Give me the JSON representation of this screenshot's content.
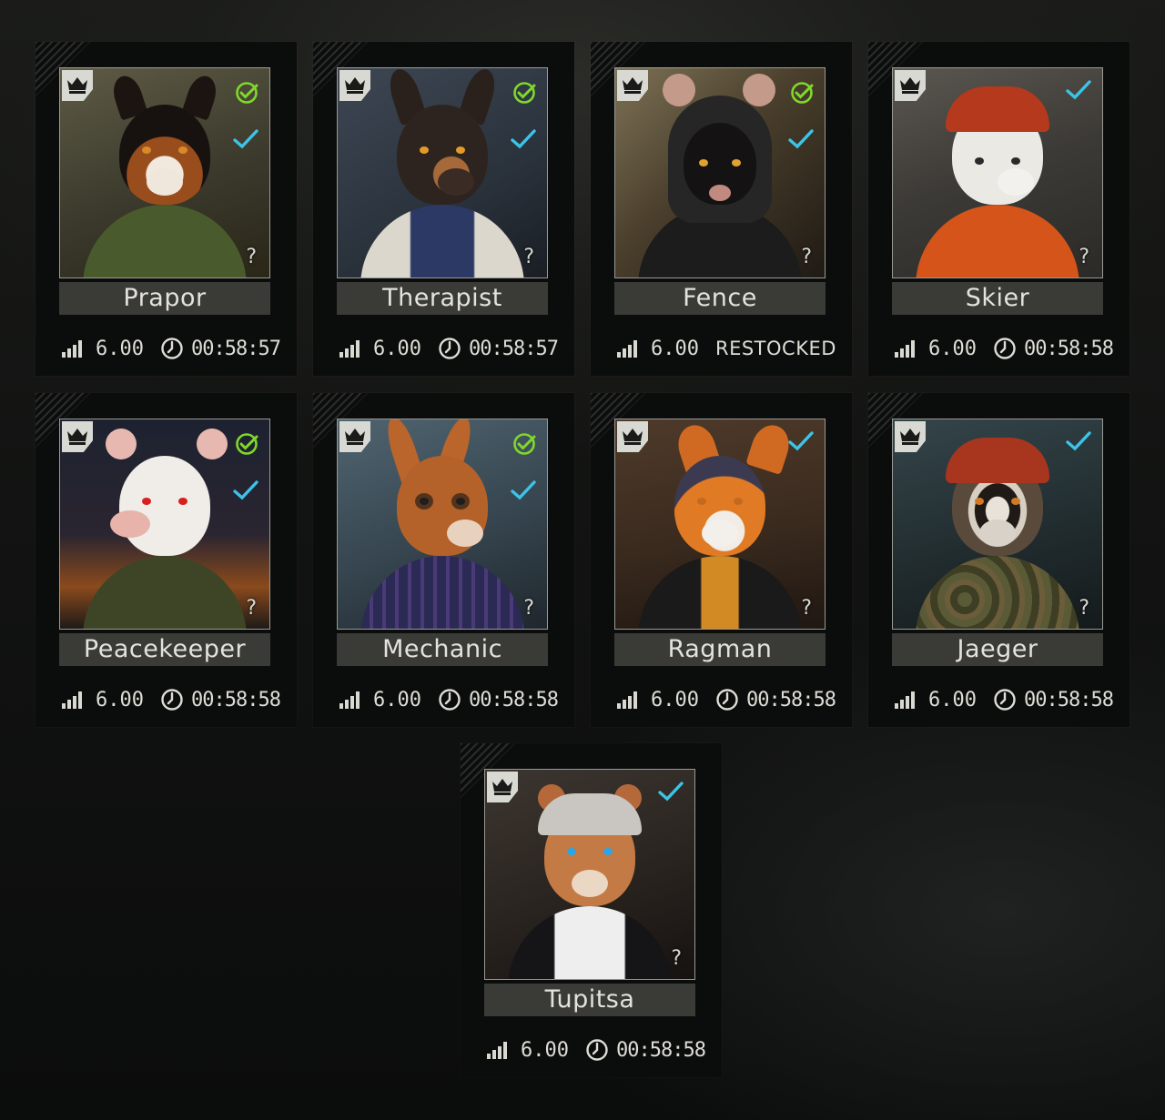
{
  "colors": {
    "check_green": "#7fd82a",
    "check_blue": "#3cc4e8",
    "plate": "#3a3a37",
    "card_bg": "#0b0c0c"
  },
  "icons": {
    "loyalty": "crown-icon",
    "level": "level-bars-icon",
    "timer": "clock-icon",
    "help": "question-icon",
    "task_done": "check-circle-icon",
    "standing": "check-icon"
  },
  "traders": [
    {
      "name": "Prapor",
      "level": "6.00",
      "restock": "00:58:57",
      "green_check": true,
      "blue_check": true
    },
    {
      "name": "Therapist",
      "level": "6.00",
      "restock": "00:58:57",
      "green_check": true,
      "blue_check": true
    },
    {
      "name": "Fence",
      "level": "6.00",
      "restock": "RESTOCKED",
      "green_check": true,
      "blue_check": true
    },
    {
      "name": "Skier",
      "level": "6.00",
      "restock": "00:58:58",
      "green_check": false,
      "blue_check": true
    },
    {
      "name": "Peacekeeper",
      "level": "6.00",
      "restock": "00:58:58",
      "green_check": true,
      "blue_check": true
    },
    {
      "name": "Mechanic",
      "level": "6.00",
      "restock": "00:58:58",
      "green_check": true,
      "blue_check": true
    },
    {
      "name": "Ragman",
      "level": "6.00",
      "restock": "00:58:58",
      "green_check": false,
      "blue_check": true
    },
    {
      "name": "Jaeger",
      "level": "6.00",
      "restock": "00:58:58",
      "green_check": false,
      "blue_check": true
    },
    {
      "name": "Tupitsa",
      "level": "6.00",
      "restock": "00:58:58",
      "green_check": false,
      "blue_check": true
    }
  ]
}
